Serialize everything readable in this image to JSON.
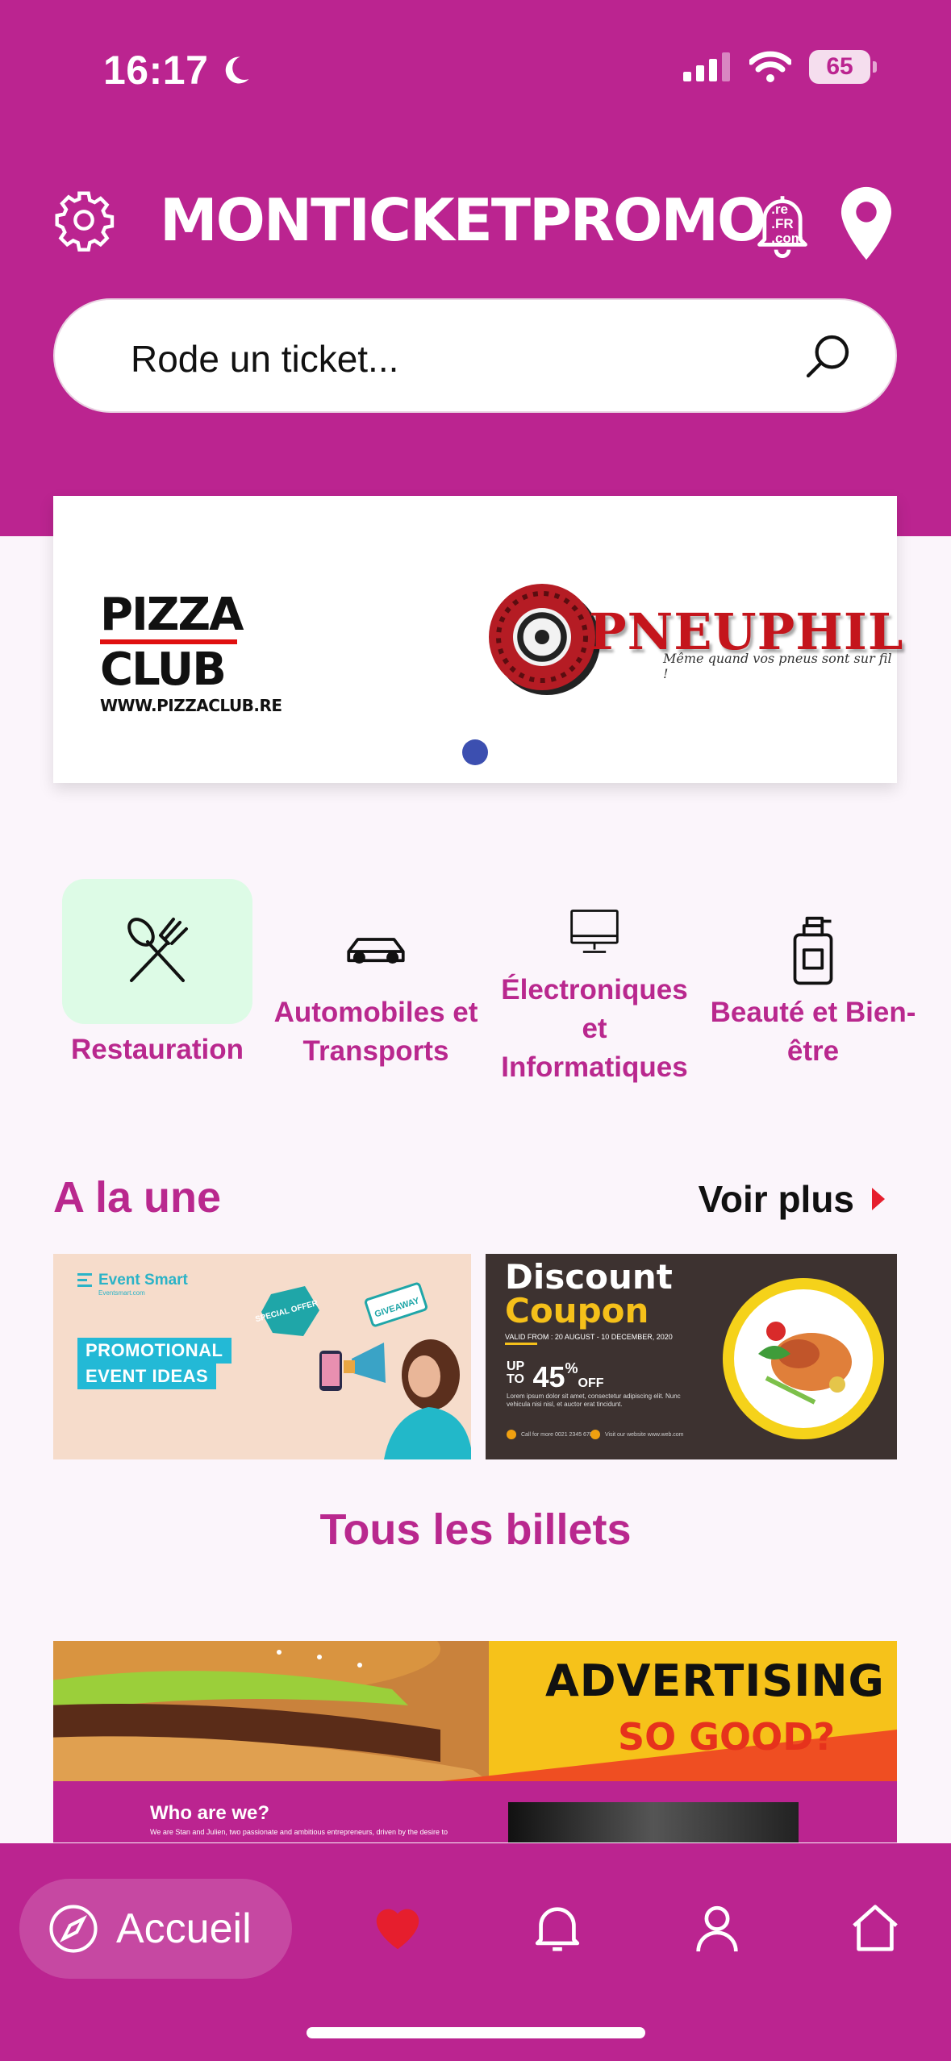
{
  "status_bar": {
    "time": "16:17",
    "battery": "65"
  },
  "header": {
    "logo": "MONTICKETPROMO",
    "logo_domains": [
      ".re",
      ".FR",
      ".com"
    ]
  },
  "search": {
    "placeholder": "Rode un ticket..."
  },
  "banner": {
    "pizza_line1": "PIZZA",
    "pizza_line2": "CLUB",
    "pizza_url": "WWW.PIZZACLUB.RE",
    "pneu_name": "PNEUPHIL",
    "pneu_slogan": "Même quand vos pneus sont sur fil !"
  },
  "categories": [
    {
      "label": "Restauration",
      "icon": "utensils-icon"
    },
    {
      "label": "Automobiles et Transports",
      "icon": "car-icon"
    },
    {
      "label": "Électroniques et Informatiques",
      "icon": "computer-icon"
    },
    {
      "label": "Beauté et Bien-être",
      "icon": "perfume-icon"
    }
  ],
  "featured": {
    "title": "A la une",
    "more": "Voir plus",
    "promo1": {
      "brand": "Event Smart",
      "brand_sub": "Eventsmart.com",
      "line1": "PROMOTIONAL",
      "line2": "EVENT IDEAS",
      "badge1": "SPECIAL OFFER",
      "badge2": "GIVEAWAY"
    },
    "promo2": {
      "title1": "Discount",
      "title2": "Coupon",
      "valid": "VALID FROM : 20 AUGUST - 10 DECEMBER, 2020",
      "up": "UP TO",
      "percent": "45",
      "off": "OFF",
      "lorem": "Lorem ipsum dolor sit amet, consectetur adipiscing elit. Nunc vehicula nisi nisl, et auctor erat tincidunt.",
      "call": "Call for more 0021 2345 6789",
      "visit": "Visit our website www.web.com"
    }
  },
  "all_tickets": {
    "title": "Tous les billets",
    "ad_title": "ADVERTISING",
    "ad_sub": "SO GOOD?",
    "ad_who": "Who are we?",
    "ad_who_sub": "We are Stan and Julien, two passionate and ambitious entrepreneurs, driven by the desire to"
  },
  "bottom_nav": {
    "home_label": "Accueil"
  },
  "colors": {
    "brand": "#bb2490",
    "accent_text": "#b9288e",
    "active_bg": "#ddfbe6",
    "heart": "#e61e2d"
  }
}
